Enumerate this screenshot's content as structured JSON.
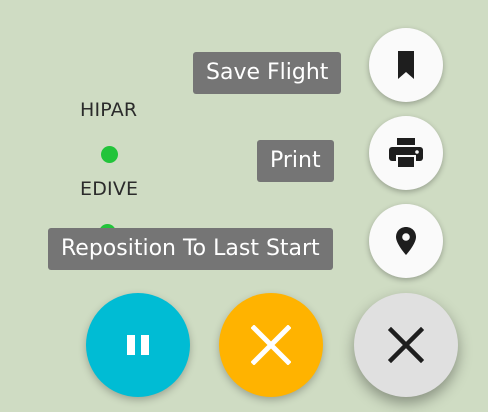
{
  "map": {
    "waypoints": [
      {
        "label": "HIPAR"
      },
      {
        "label": "EDIVE"
      }
    ]
  },
  "menu": {
    "items": [
      {
        "label": "Save Flight",
        "icon": "bookmark-icon"
      },
      {
        "label": "Print",
        "icon": "printer-icon"
      },
      {
        "label": "Reposition To Last Start",
        "icon": "location-pin-icon"
      }
    ]
  },
  "controls": {
    "pause_icon": "pause-icon",
    "cancel_icon": "close-icon",
    "close_icon": "close-icon"
  },
  "colors": {
    "map_background": "#cfdcc3",
    "waypoint": "#22c43a",
    "tooltip_bg": "#757575",
    "pause_fab": "#00bcd4",
    "cancel_fab": "#ffb300",
    "close_fab": "#e0e0e0"
  }
}
